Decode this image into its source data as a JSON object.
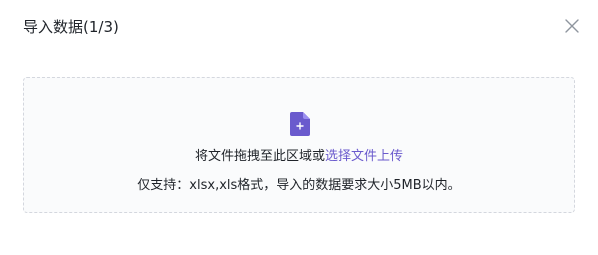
{
  "dialog": {
    "title": "导入数据(1/3)",
    "close_icon": "close-icon"
  },
  "upload": {
    "file_icon": "file-plus-icon",
    "drop_text": "将文件拖拽至此区域或",
    "select_link": "选择文件上传",
    "format_text": "仅支持：xlsx,xls格式，导入的数据要求大小5MB以内。"
  },
  "colors": {
    "accent": "#6a5acd",
    "text": "#1f2329",
    "border": "#d4d7de",
    "close_icon": "#8f959e"
  }
}
